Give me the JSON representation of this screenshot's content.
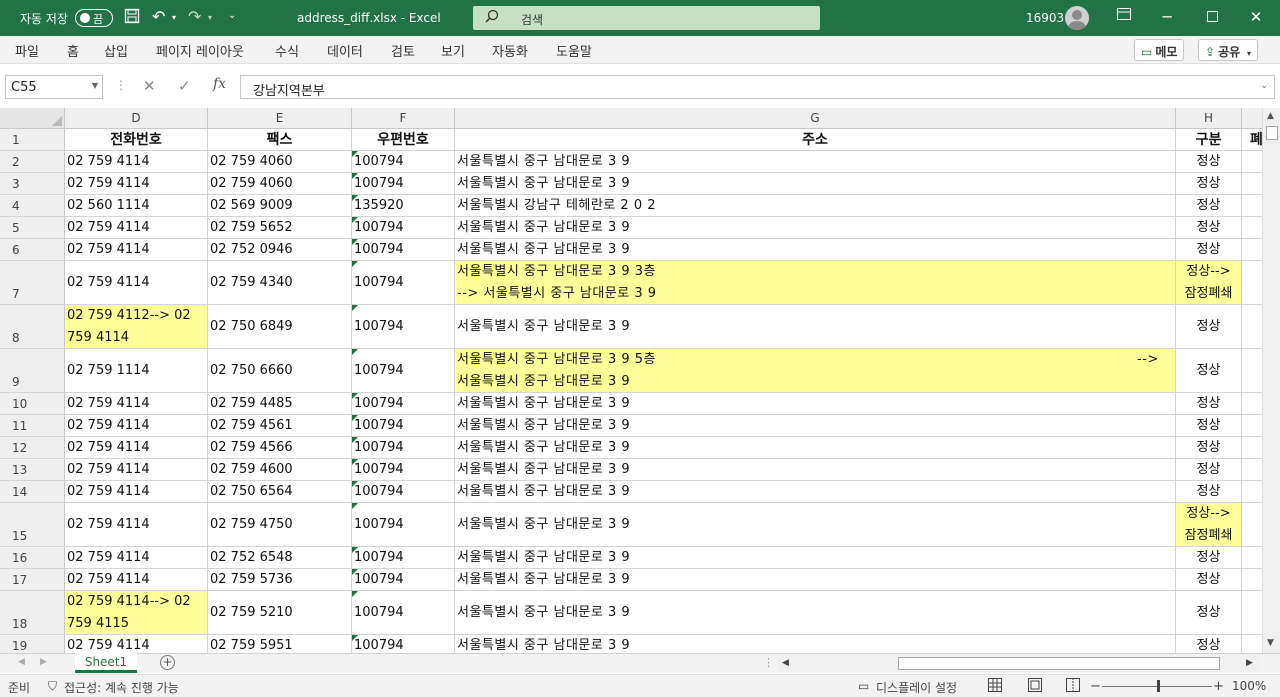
{
  "titlebar": {
    "autosave_label": "자동 저장",
    "autosave_state": "끔",
    "document_title": "address_diff.xlsx  -  Excel",
    "search_placeholder": "검색",
    "user_id": "16903",
    "icons": [
      "save-icon",
      "undo-icon",
      "redo-icon",
      "customize-icon",
      "search-icon",
      "ribbon-display-icon",
      "minimize-icon",
      "maximize-icon",
      "close-icon"
    ]
  },
  "ribbon": {
    "tabs": [
      "파일",
      "홈",
      "삽입",
      "페이지 레이아웃",
      "수식",
      "데이터",
      "검토",
      "보기",
      "자동화",
      "도움말"
    ],
    "memo_label": "메모",
    "share_label": "공유"
  },
  "formula_bar": {
    "name_box": "C55",
    "formula": "강남지역본부",
    "fx_label": "fx"
  },
  "grid": {
    "column_letters": [
      "D",
      "E",
      "F",
      "G",
      "H",
      ""
    ],
    "header_row": {
      "row_num": "1",
      "cells": [
        "전화번호",
        "팩스",
        "우편번호",
        "주소",
        "구분",
        "폐"
      ]
    },
    "rows": [
      {
        "row_num": "2",
        "phone": "02 759 4114",
        "fax": "02 759 4060",
        "zip": "100794",
        "address": "서울특별시   중구   남대문로   3 9",
        "type": "정상"
      },
      {
        "row_num": "3",
        "phone": "02 759 4114",
        "fax": "02 759 4060",
        "zip": "100794",
        "address": "서울특별시   중구   남대문로   3 9",
        "type": "정상"
      },
      {
        "row_num": "4",
        "phone": "02 560 1114",
        "fax": "02 569 9009",
        "zip": "135920",
        "address": "서울특별시   강남구   테헤란로   2 0 2",
        "type": "정상"
      },
      {
        "row_num": "5",
        "phone": "02 759 4114",
        "fax": "02 759 5652",
        "zip": "100794",
        "address": "서울특별시   중구   남대문로   3 9",
        "type": "정상"
      },
      {
        "row_num": "6",
        "phone": "02 759 4114",
        "fax": "02 752 0946",
        "zip": "100794",
        "address": "서울특별시   중구   남대문로   3 9",
        "type": "정상"
      },
      {
        "row_num": "7",
        "phone": "02 759 4114",
        "fax": "02 759 4340",
        "zip": "100794",
        "address": "서울특별시   중구   남대문로   3 9  3층",
        "address2": "--> 서울특별시   중구   남대문로   3 9",
        "type": "정상-->",
        "type2": "잠정폐쇄"
      },
      {
        "row_num": "8",
        "phone": "02 759 4112--> 02",
        "phone2": "759 4114",
        "fax": "02 750 6849",
        "zip": "100794",
        "address": "서울특별시   중구   남대문로   3 9",
        "type": "정상"
      },
      {
        "row_num": "9",
        "phone": "02 759 1114",
        "fax": "02 750 6660",
        "zip": "100794",
        "address": "서울특별시   중구   남대문로   3 9  5층",
        "address_arrow": "-->",
        "address2": "서울특별시   중구   남대문로   3 9",
        "type": "정상"
      },
      {
        "row_num": "10",
        "phone": "02 759 4114",
        "fax": "02 759 4485",
        "zip": "100794",
        "address": "서울특별시   중구   남대문로   3 9",
        "type": "정상"
      },
      {
        "row_num": "11",
        "phone": "02 759 4114",
        "fax": "02 759 4561",
        "zip": "100794",
        "address": "서울특별시   중구   남대문로   3 9",
        "type": "정상"
      },
      {
        "row_num": "12",
        "phone": "02 759 4114",
        "fax": "02 759 4566",
        "zip": "100794",
        "address": "서울특별시   중구   남대문로   3 9",
        "type": "정상"
      },
      {
        "row_num": "13",
        "phone": "02 759 4114",
        "fax": "02 759 4600",
        "zip": "100794",
        "address": "서울특별시   중구   남대문로   3 9",
        "type": "정상"
      },
      {
        "row_num": "14",
        "phone": "02 759 4114",
        "fax": "02 750 6564",
        "zip": "100794",
        "address": "서울특별시   중구   남대문로   3 9",
        "type": "정상"
      },
      {
        "row_num": "15",
        "phone": "02 759 4114",
        "fax": "02 759 4750",
        "zip": "100794",
        "address": "서울특별시   중구   남대문로   3 9",
        "type": "정상-->",
        "type2": "잠정폐쇄"
      },
      {
        "row_num": "16",
        "phone": "02 759 4114",
        "fax": "02 752 6548",
        "zip": "100794",
        "address": "서울특별시   중구   남대문로   3 9",
        "type": "정상"
      },
      {
        "row_num": "17",
        "phone": "02 759 4114",
        "fax": "02 759 5736",
        "zip": "100794",
        "address": "서울특별시   중구   남대문로   3 9",
        "type": "정상"
      },
      {
        "row_num": "18",
        "phone": "02 759 4114--> 02",
        "phone2": "759 4115",
        "fax": "02 759 5210",
        "zip": "100794",
        "address": "서울특별시   중구   남대문로   3 9",
        "type": "정상"
      },
      {
        "row_num": "19",
        "phone": "02 759 4114",
        "fax": "02 759 5951",
        "zip": "100794",
        "address": "서울특별시   중구   남대문로   3 9",
        "type": "정상"
      }
    ],
    "highlight_color": "#ffff99"
  },
  "sheets": {
    "tabs": [
      "Sheet1"
    ],
    "active": "Sheet1"
  },
  "statusbar": {
    "ready": "준비",
    "accessibility": "접근성: 계속 진행 가능",
    "display_settings": "디스플레이 설정",
    "zoom": "100%"
  },
  "colors": {
    "excel_green": "#217346",
    "highlight": "#ffff99"
  }
}
